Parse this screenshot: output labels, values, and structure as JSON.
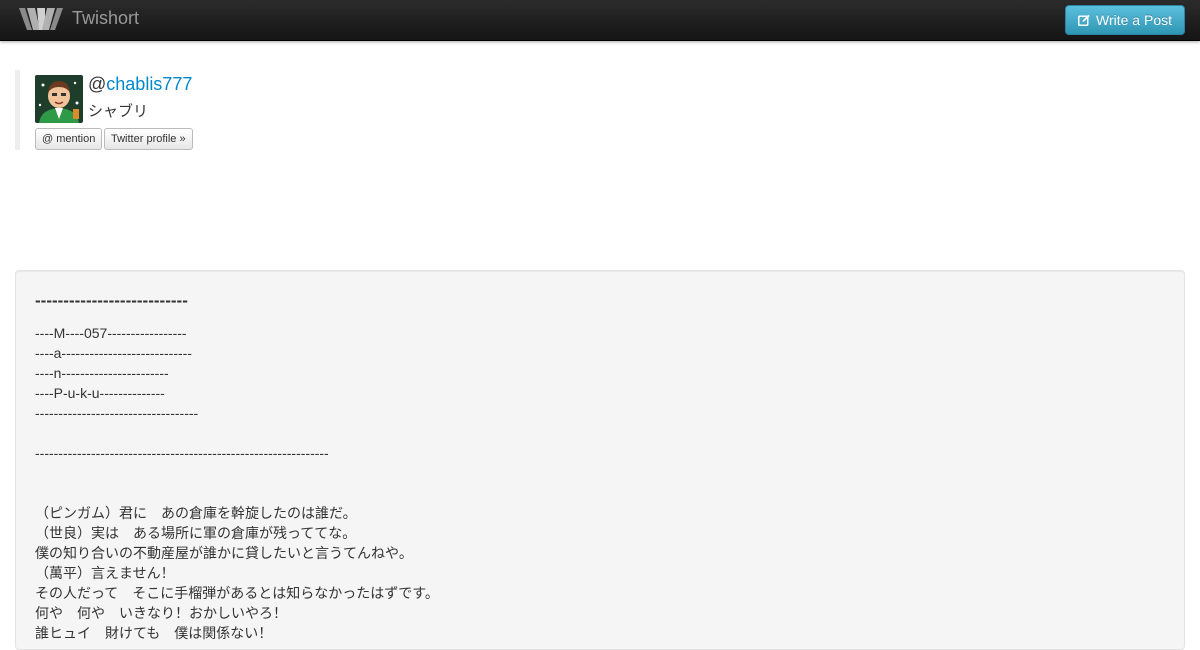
{
  "navbar": {
    "brand": "Twishort",
    "write_button": "Write a Post"
  },
  "profile": {
    "at": "@",
    "username": "chablis777",
    "display_name": "シャブリ",
    "mention_button": "@ mention",
    "twitter_button": "Twitter profile »"
  },
  "post": {
    "heading": "---------------------------",
    "lines": [
      "----M----057-----------------",
      "----a----------------------------",
      "----n-----------------------",
      "----P-u-k-u--------------",
      "-----------------------------------",
      "",
      "---------------------------------------------------------------",
      "",
      "",
      "（ピンガム）君に　あの倉庫を幹旋したのは誰だ。",
      "（世良）実は　ある場所に軍の倉庫が残っててな。",
      "僕の知り合いの不動産屋が誰かに貸したいと言うてんねや。",
      "（萬平）言えません！",
      "その人だって　そこに手榴弾があるとは知らなかったはずです。",
      "何や　何や　いきなり！おかしいやろ！",
      "誰ヒュイ　財けても　僕は関係ない！"
    ]
  }
}
